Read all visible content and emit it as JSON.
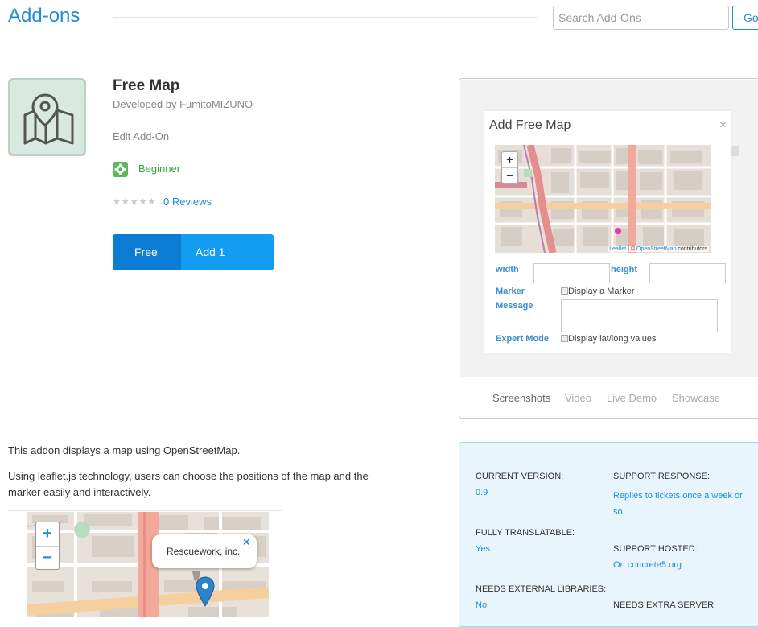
{
  "header": {
    "title": "Add-ons",
    "search": {
      "placeholder": "Search Add-Ons",
      "value": ""
    },
    "go_label": "Go"
  },
  "addon": {
    "icon": "map-pin-icon",
    "name": "Free Map",
    "developer": "Developed by FumitoMIZUNO",
    "edit_label": "Edit Add-On",
    "level": {
      "icon": "gear-icon",
      "label": "Beginner"
    },
    "rating": {
      "stars": "★★★★★",
      "reviews_label": "0 Reviews"
    },
    "price_label": "Free",
    "add_label": "Add 1"
  },
  "screenshot": {
    "dialog_title": "Add Free Map",
    "close_glyph": "×",
    "map": {
      "zoom_in": "+",
      "zoom_out": "−",
      "attribution": {
        "prefix": "Leaflet",
        "sep": " | © ",
        "link": "OpenStreetMap",
        "suffix": " contributors"
      }
    },
    "fields": {
      "width_label": "width",
      "height_label": "height",
      "marker_label": "Marker",
      "marker_option": "Display a Marker",
      "message_label": "Message",
      "expert_label": "Expert Mode",
      "expert_option": "Display lat/long values"
    }
  },
  "tabs": [
    {
      "label": "Screenshots",
      "active": true
    },
    {
      "label": "Video",
      "active": false
    },
    {
      "label": "Live Demo",
      "active": false
    },
    {
      "label": "Showcase",
      "active": false
    }
  ],
  "description": {
    "p1": "This addon displays a map using OpenStreetMap.",
    "p2": "Using leaflet.js technology, users can choose the positions of the map and the marker easily and interactively."
  },
  "demo_map": {
    "zoom_in": "+",
    "zoom_out": "−",
    "popup_text": "Rescuework, inc.",
    "popup_close": "×"
  },
  "details": {
    "current_version": {
      "label": "CURRENT VERSION:",
      "value": "0.9"
    },
    "support_response": {
      "label": "SUPPORT RESPONSE:",
      "value": "Replies to tickets once a week or so."
    },
    "fully_translatable": {
      "label": "FULLY TRANSLATABLE:",
      "value": "Yes"
    },
    "support_hosted": {
      "label": "SUPPORT HOSTED:",
      "value": "On concrete5.org"
    },
    "needs_external_libraries": {
      "label": "NEEDS EXTERNAL LIBRARIES:",
      "value": "No"
    },
    "needs_extra_server": {
      "label": "NEEDS EXTRA SERVER"
    }
  },
  "colors": {
    "accent": "#1f8dd6",
    "button_dark": "#0b7cd4",
    "button_light": "#129cf2",
    "level_green": "#5cb85c",
    "details_bg": "#e8f5fc"
  }
}
